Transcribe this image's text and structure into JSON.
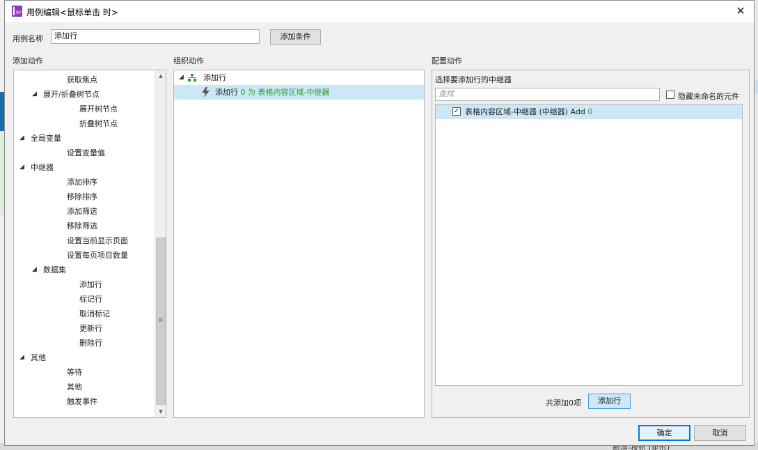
{
  "dialog": {
    "title": "用例编辑<鼠标单击 时>",
    "close_glyph": "✕",
    "icon_text": "RP"
  },
  "case_name": {
    "label": "用例名称",
    "value": "添加行",
    "add_condition": "添加条件"
  },
  "add_actions": {
    "heading": "添加动作",
    "items": [
      {
        "label": "获取焦点",
        "level": 2,
        "expand": ""
      },
      {
        "label": "展开/折叠树节点",
        "level": 1,
        "expand": "◢"
      },
      {
        "label": "展开树节点",
        "level": 3,
        "expand": ""
      },
      {
        "label": "折叠树节点",
        "level": 3,
        "expand": ""
      },
      {
        "label": "全局变量",
        "level": 0,
        "expand": "◢"
      },
      {
        "label": "设置变量值",
        "level": 2,
        "expand": ""
      },
      {
        "label": "中继器",
        "level": 0,
        "expand": "◢"
      },
      {
        "label": "添加排序",
        "level": 2,
        "expand": ""
      },
      {
        "label": "移除排序",
        "level": 2,
        "expand": ""
      },
      {
        "label": "添加筛选",
        "level": 2,
        "expand": ""
      },
      {
        "label": "移除筛选",
        "level": 2,
        "expand": ""
      },
      {
        "label": "设置当前显示页面",
        "level": 2,
        "expand": ""
      },
      {
        "label": "设置每页项目数量",
        "level": 2,
        "expand": ""
      },
      {
        "label": "数据集",
        "level": 1,
        "expand": "◢"
      },
      {
        "label": "添加行",
        "level": 3,
        "expand": ""
      },
      {
        "label": "标记行",
        "level": 3,
        "expand": ""
      },
      {
        "label": "取消标记",
        "level": 3,
        "expand": ""
      },
      {
        "label": "更新行",
        "level": 3,
        "expand": ""
      },
      {
        "label": "删除行",
        "level": 3,
        "expand": ""
      },
      {
        "label": "其他",
        "level": 0,
        "expand": "◢"
      },
      {
        "label": "等待",
        "level": 2,
        "expand": ""
      },
      {
        "label": "其他",
        "level": 2,
        "expand": ""
      },
      {
        "label": "触发事件",
        "level": 2,
        "expand": ""
      }
    ]
  },
  "organize": {
    "heading": "组织动作",
    "case_label": "添加行",
    "action_prefix": "添加行",
    "action_count": "0",
    "action_for": "为",
    "action_target": "表格内容区域-中继器"
  },
  "configure": {
    "heading": "配置动作",
    "subheading": "选择要添加行的中继器",
    "search_placeholder": "查找",
    "hide_unnamed": "隐藏未命名的元件",
    "item_label": "表格内容区域-中继器 (中继器) Add",
    "item_count": "0",
    "item_checked": "✓",
    "total_text": "共添加0项",
    "add_row_button": "添加行"
  },
  "footer": {
    "ok": "确定",
    "cancel": "取消"
  },
  "background": {
    "bottom_text": "新增-按钮 (矩形)"
  },
  "colors": {
    "selection": "#cce8f7",
    "accent_text": "#2a9a2a",
    "icon_purple": "#8a3ab8"
  }
}
